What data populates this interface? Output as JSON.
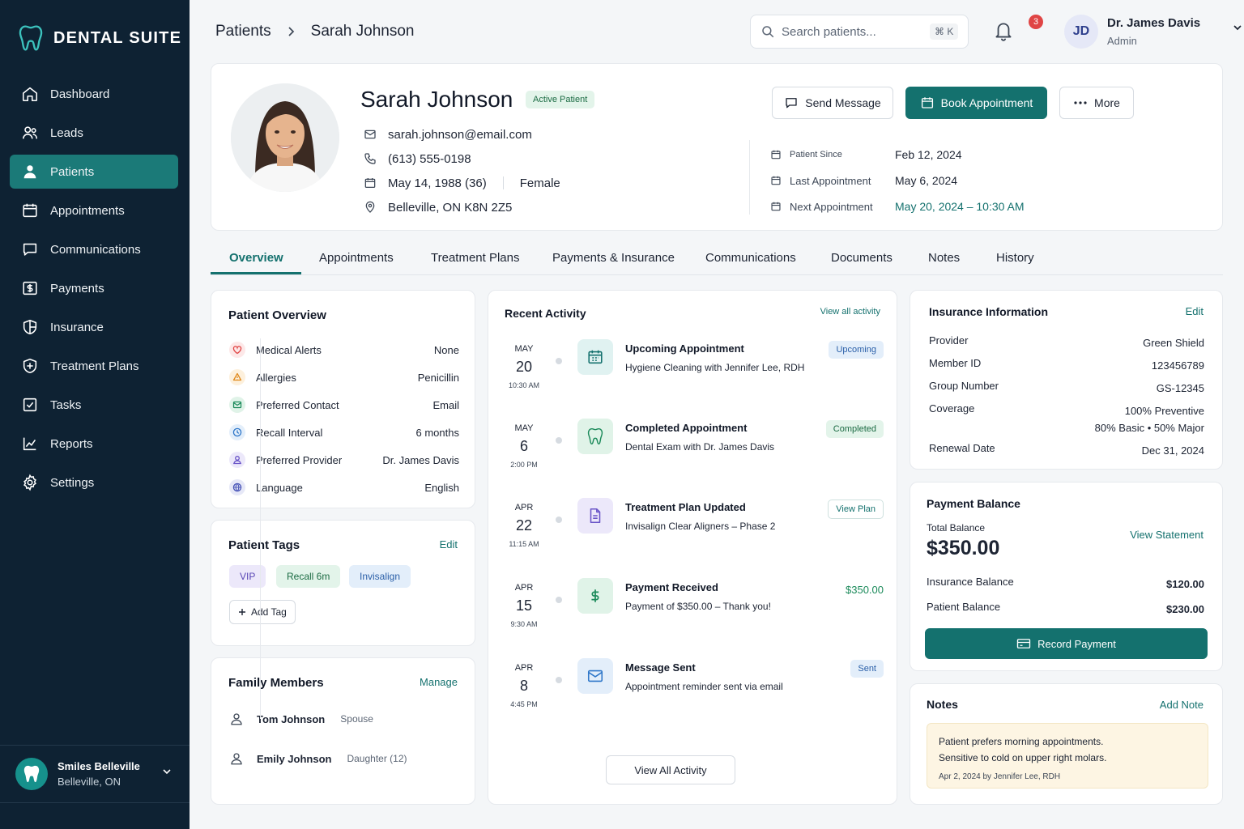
{
  "app": {
    "name": "DENTAL SUITE"
  },
  "sidebar": {
    "items": [
      {
        "label": "Dashboard",
        "icon": "home-icon"
      },
      {
        "label": "Leads",
        "icon": "users-icon"
      },
      {
        "label": "Patients",
        "icon": "user-icon",
        "active": true
      },
      {
        "label": "Appointments",
        "icon": "calendar-icon"
      },
      {
        "label": "Communications",
        "icon": "message-icon"
      },
      {
        "label": "Payments",
        "icon": "dollar-icon"
      },
      {
        "label": "Insurance",
        "icon": "shield-icon"
      },
      {
        "label": "Treatment Plans",
        "icon": "shield-plus-icon"
      },
      {
        "label": "Tasks",
        "icon": "checkbox-icon"
      },
      {
        "label": "Reports",
        "icon": "chart-icon"
      },
      {
        "label": "Settings",
        "icon": "gear-icon"
      }
    ],
    "clinic": {
      "name": "Smiles Belleville",
      "location": "Belleville, ON"
    }
  },
  "header": {
    "breadcrumb": {
      "parent": "Patients",
      "current": "Sarah Johnson"
    },
    "search": {
      "placeholder": "Search patients...",
      "shortcut": "⌘ K"
    },
    "notifications": {
      "count": "3"
    },
    "user": {
      "initials": "JD",
      "name": "Dr. James Davis",
      "role": "Admin"
    }
  },
  "patient": {
    "name": "Sarah Johnson",
    "status": "Active Patient",
    "email": "sarah.johnson@email.com",
    "phone": "(613) 555-0198",
    "dob": "May 14, 1988 (36)",
    "gender": "Female",
    "address": "Belleville, ON K8N 2Z5",
    "actions": {
      "message": "Send Message",
      "book": "Book Appointment",
      "more": "More"
    },
    "dates": [
      {
        "label": "Patient Since",
        "value": "Feb 12, 2024"
      },
      {
        "label": "Last Appointment",
        "value": "May 6, 2024"
      },
      {
        "label": "Next Appointment",
        "value": "May 20, 2024 – 10:30 AM"
      }
    ]
  },
  "tabs": [
    "Overview",
    "Appointments",
    "Treatment Plans",
    "Payments & Insurance",
    "Communications",
    "Documents",
    "Notes",
    "History"
  ],
  "overview": {
    "title": "Patient Overview",
    "rows": [
      {
        "label": "Medical Alerts",
        "value": "None",
        "icon": "heart-icon",
        "color": "#e04545",
        "bg": "#fde8e8"
      },
      {
        "label": "Allergies",
        "value": "Penicillin",
        "icon": "warning-icon",
        "color": "#e08a1e",
        "bg": "#fdf0dc"
      },
      {
        "label": "Preferred Contact",
        "value": "Email",
        "icon": "mail-icon",
        "color": "#1b8a5a",
        "bg": "#e0f3e8"
      },
      {
        "label": "Recall Interval",
        "value": "6 months",
        "icon": "clock-icon",
        "color": "#2f77c9",
        "bg": "#e3eefa"
      },
      {
        "label": "Preferred Provider",
        "value": "Dr. James Davis",
        "icon": "person-icon",
        "color": "#6a55c8",
        "bg": "#ece8fa"
      },
      {
        "label": "Language",
        "value": "English",
        "icon": "globe-icon",
        "color": "#4a56b8",
        "bg": "#e6e8f7"
      }
    ]
  },
  "tags": {
    "title": "Patient Tags",
    "edit": "Edit",
    "items": [
      "VIP",
      "Recall 6m",
      "Invisalign"
    ],
    "add": "Add Tag"
  },
  "family": {
    "title": "Family Members",
    "manage": "Manage",
    "members": [
      {
        "name": "Tom Johnson",
        "relation": "Spouse"
      },
      {
        "name": "Emily Johnson",
        "relation": "Daughter (12)"
      }
    ]
  },
  "activity": {
    "title": "Recent Activity",
    "view_all_link": "View all activity",
    "view_all_button": "View All Activity",
    "items": [
      {
        "month": "MAY",
        "day": "20",
        "time": "10:30 AM",
        "title": "Upcoming Appointment",
        "desc": "Hygiene Cleaning with Jennifer Lee, RDH",
        "badge": "Upcoming",
        "icon": "calendar-icon"
      },
      {
        "month": "MAY",
        "day": "6",
        "time": "2:00 PM",
        "title": "Completed Appointment",
        "desc": "Dental Exam with Dr. James Davis",
        "badge": "Completed",
        "icon": "tooth-icon"
      },
      {
        "month": "APR",
        "day": "22",
        "time": "11:15 AM",
        "title": "Treatment Plan Updated",
        "desc": "Invisalign Clear Aligners – Phase 2",
        "badge": "View Plan",
        "icon": "document-icon"
      },
      {
        "month": "APR",
        "day": "15",
        "time": "9:30 AM",
        "title": "Payment Received",
        "desc": "Payment of $350.00 – Thank you!",
        "badge": "$350.00",
        "icon": "dollar-icon"
      },
      {
        "month": "APR",
        "day": "8",
        "time": "4:45 PM",
        "title": "Message Sent",
        "desc": "Appointment reminder sent via email",
        "badge": "Sent",
        "icon": "mail-icon"
      }
    ]
  },
  "insurance": {
    "title": "Insurance Information",
    "edit": "Edit",
    "rows": [
      {
        "label": "Provider",
        "value": "Green Shield"
      },
      {
        "label": "Member ID",
        "value": "123456789"
      },
      {
        "label": "Group Number",
        "value": "GS-12345"
      },
      {
        "label": "Coverage",
        "value": "100% Preventive",
        "value2": "80% Basic • 50% Major"
      },
      {
        "label": "Renewal Date",
        "value": "Dec 31, 2024"
      }
    ]
  },
  "payment": {
    "title": "Payment Balance",
    "total_label": "Total Balance",
    "total": "$350.00",
    "statement": "View Statement",
    "insurance_label": "Insurance Balance",
    "insurance_value": "$120.00",
    "patient_label": "Patient Balance",
    "patient_value": "$230.00",
    "record": "Record Payment"
  },
  "notes": {
    "title": "Notes",
    "add": "Add Note",
    "text1": "Patient prefers morning appointments.",
    "text2": "Sensitive to cold on upper right molars.",
    "meta": "Apr 2, 2024 by Jennifer Lee, RDH"
  },
  "colors": {
    "accent": "#14716e",
    "sidebar": "#0e2233",
    "active_nav": "#1b7a78"
  }
}
